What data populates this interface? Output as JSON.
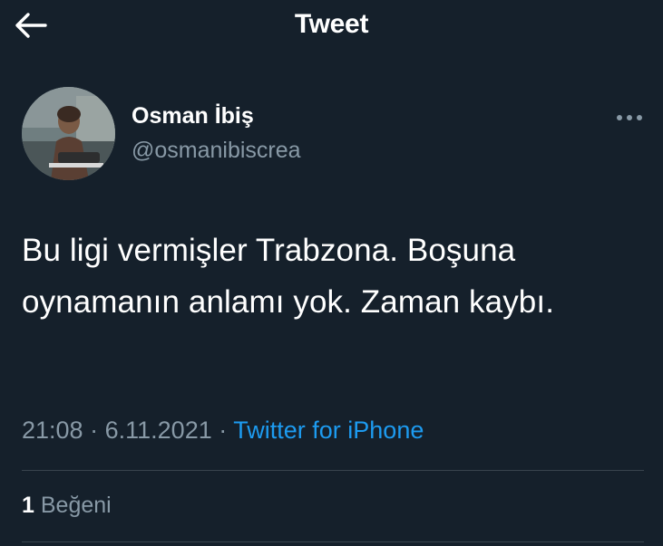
{
  "header": {
    "title": "Tweet",
    "back_icon": "arrow-left-icon"
  },
  "author": {
    "name": "Osman İbiş",
    "handle": "@osmanibiscrea",
    "more_icon": "more-horizontal-icon"
  },
  "tweet": {
    "text": "Bu ligi vermişler Trabzona. Boşuna oynamanın anlamı yok. Zaman kaybı.",
    "time": "21:08",
    "date": "6.11.2021",
    "separator": "·",
    "source": "Twitter for iPhone"
  },
  "stats": {
    "likes_count": "1",
    "likes_label": "Beğeni"
  },
  "colors": {
    "background": "#15202b",
    "text_primary": "#ffffff",
    "text_secondary": "#8899a6",
    "link": "#1d9bf0",
    "divider": "#38444d"
  }
}
